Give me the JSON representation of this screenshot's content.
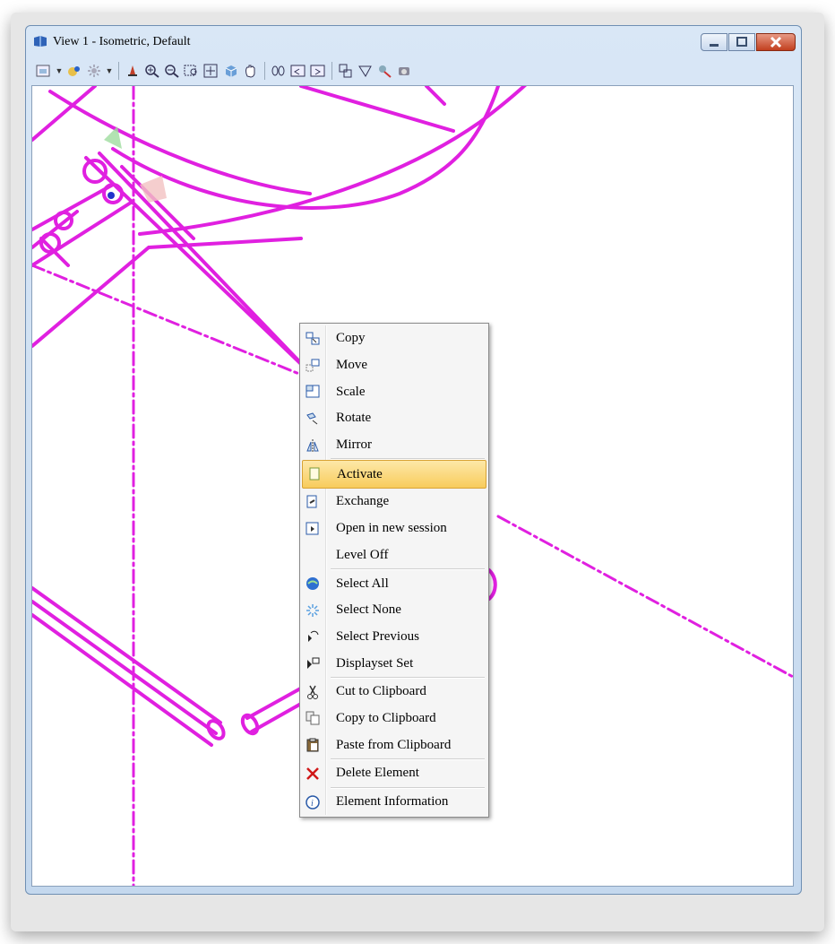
{
  "window": {
    "title": "View 1 - Isometric, Default",
    "accent": "#c2401f"
  },
  "toolbar": {
    "icons": [
      "view-attributes-icon",
      "display-style-icon",
      "lighting-icon",
      "update-view-icon",
      "zoom-in-icon",
      "zoom-out-icon",
      "window-area-icon",
      "fit-view-icon",
      "rotate-view-icon",
      "pan-view-icon",
      "walk-icon",
      "previous-view-icon",
      "next-view-icon",
      "copy-view-icon",
      "clip-volume-icon",
      "clip-mask-icon",
      "camera-icon"
    ]
  },
  "canvas": {
    "element_color": "#e020e0"
  },
  "menu": {
    "groups": [
      [
        {
          "label": "Copy",
          "icon": "copy-icon"
        },
        {
          "label": "Move",
          "icon": "move-icon"
        },
        {
          "label": "Scale",
          "icon": "scale-icon"
        },
        {
          "label": "Rotate",
          "icon": "rotate-icon"
        },
        {
          "label": "Mirror",
          "icon": "mirror-icon"
        }
      ],
      [
        {
          "label": "Activate",
          "icon": "activate-icon",
          "highlighted": true
        },
        {
          "label": "Exchange",
          "icon": "exchange-icon"
        },
        {
          "label": "Open in new session",
          "icon": "open-session-icon"
        },
        {
          "label": "Level Off",
          "icon": ""
        }
      ],
      [
        {
          "label": "Select All",
          "icon": "select-all-icon"
        },
        {
          "label": "Select None",
          "icon": "select-none-icon"
        },
        {
          "label": "Select Previous",
          "icon": "select-previous-icon"
        },
        {
          "label": "Displayset Set",
          "icon": "displayset-icon"
        }
      ],
      [
        {
          "label": "Cut to Clipboard",
          "icon": "scissors-icon"
        },
        {
          "label": "Copy to Clipboard",
          "icon": "copy-clipboard-icon"
        },
        {
          "label": "Paste from Clipboard",
          "icon": "paste-icon"
        }
      ],
      [
        {
          "label": "Delete Element",
          "icon": "delete-icon"
        }
      ],
      [
        {
          "label": "Element Information",
          "icon": "info-icon"
        }
      ]
    ]
  }
}
